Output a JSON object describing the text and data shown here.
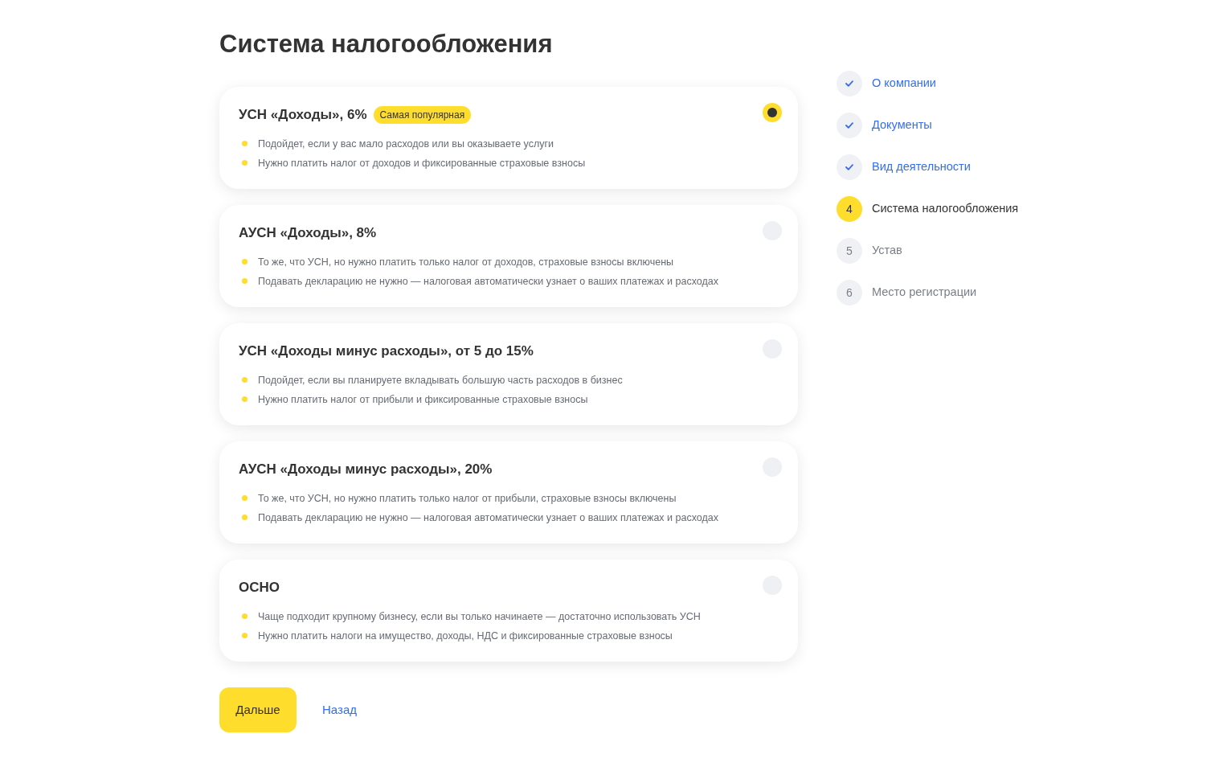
{
  "title": "Система налогообложения",
  "options": [
    {
      "title": "УСН «Доходы», 6%",
      "badge": "Самая популярная",
      "selected": true,
      "bullets": [
        "Подойдет, если у вас мало расходов или вы оказываете услуги",
        "Нужно платить налог от доходов и фиксированные страховые взносы"
      ]
    },
    {
      "title": "АУСН «Доходы», 8%",
      "selected": false,
      "bullets": [
        "То же, что УСН, но нужно платить только налог от доходов, страховые взносы включены",
        "Подавать декларацию не нужно — налоговая автоматически узнает о ваших платежах и расходах"
      ]
    },
    {
      "title": "УСН «Доходы минус расходы», от 5 до 15%",
      "selected": false,
      "bullets": [
        "Подойдет, если вы планируете вкладывать большую часть расходов в бизнес",
        "Нужно платить налог от прибыли и фиксированные страховые взносы"
      ]
    },
    {
      "title": "АУСН «Доходы минус расходы», 20%",
      "selected": false,
      "bullets": [
        "То же, что УСН, но нужно платить только налог от прибыли, страховые взносы включены",
        "Подавать декларацию не нужно — налоговая автоматически узнает о ваших платежах и расходах"
      ]
    },
    {
      "title": "ОСНО",
      "selected": false,
      "bullets": [
        "Чаще подходит крупному бизнесу, если вы только начинаете — достаточно использовать УСН",
        "Нужно платить налоги на имущество, доходы, НДС и фиксированные страховые взносы"
      ]
    }
  ],
  "buttons": {
    "next": "Дальше",
    "back": "Назад"
  },
  "steps": [
    {
      "done": true,
      "current": false,
      "label": "О компании"
    },
    {
      "done": true,
      "current": false,
      "label": "Документы"
    },
    {
      "done": true,
      "current": false,
      "label": "Вид деятельности"
    },
    {
      "done": false,
      "current": true,
      "number": "4",
      "label": "Система налогообложения"
    },
    {
      "done": false,
      "current": false,
      "number": "5",
      "label": "Устав"
    },
    {
      "done": false,
      "current": false,
      "number": "6",
      "label": "Место регистрации"
    }
  ]
}
